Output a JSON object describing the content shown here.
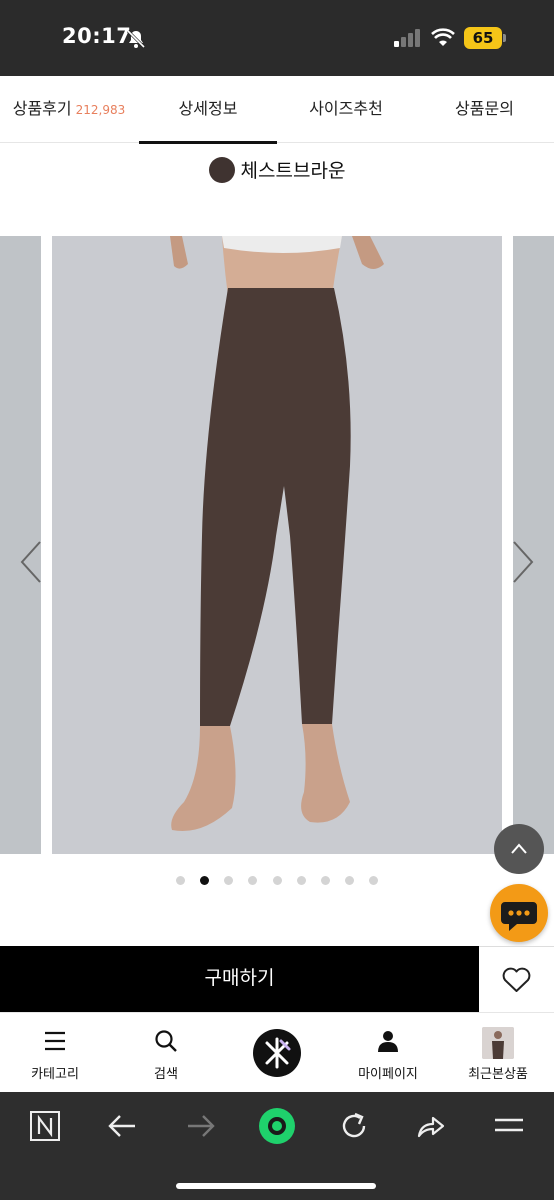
{
  "status_bar": {
    "time": "20:17",
    "battery": "65"
  },
  "tabs": [
    {
      "label": "상품후기",
      "count": "212,983"
    },
    {
      "label": "상세정보"
    },
    {
      "label": "사이즈추천"
    },
    {
      "label": "상품문의"
    }
  ],
  "active_tab": "상세정보",
  "product": {
    "color_name": "체스트브라운",
    "color_hex": "#3f3330"
  },
  "carousel": {
    "slide_count": 9,
    "active_index": 1
  },
  "buy_button": {
    "label": "구매하기"
  },
  "bottom_nav": [
    {
      "label": "카테고리",
      "icon": "menu-icon"
    },
    {
      "label": "검색",
      "icon": "search-icon"
    },
    {
      "label": "",
      "icon": "home-logo-icon"
    },
    {
      "label": "마이페이지",
      "icon": "person-icon"
    },
    {
      "label": "최근본상품",
      "icon": "recent-product-thumbnail"
    }
  ],
  "browser_toolbar": [
    "n-tab-icon",
    "back-icon",
    "forward-icon",
    "green-home-icon",
    "reload-icon",
    "share-icon",
    "menu-icon"
  ],
  "colors": {
    "accent_count": "#e8805e",
    "chat": "#f39a16",
    "status_bg": "#2b2b2b"
  }
}
